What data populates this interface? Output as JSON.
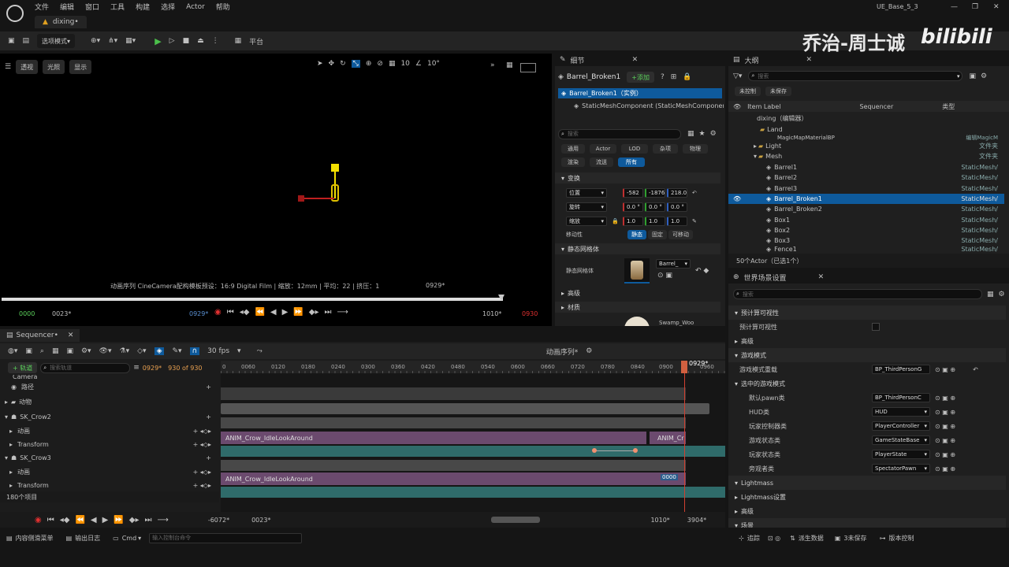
{
  "menu": {
    "items": [
      "文件",
      "编辑",
      "窗口",
      "工具",
      "构建",
      "选择",
      "Actor",
      "帮助"
    ],
    "project": "UE_Base_5_3",
    "tab": "dixing•"
  },
  "toolbar": {
    "mode": "选项模式",
    "platform": "平台"
  },
  "watermark": "乔治-周士诚",
  "viewport": {
    "perspective": "透视",
    "lit": "光照",
    "show": "显示",
    "grid": "10",
    "angle": "10°",
    "info": "动画序列 CineCamera配构模板预设：16:9 Digital Film | 缩放：12mm | 平均：22 | 挤压：1",
    "frame": "0929*",
    "start": "0000",
    "sub": "0023*",
    "cur": "0929*",
    "end": "1010*",
    "endred": "0930"
  },
  "details": {
    "tab": "细节",
    "actor": "Barrel_Broken1",
    "add": "+添加",
    "instance": "Barrel_Broken1（实例）",
    "component": "StaticMeshComponent (StaticMeshComponent)",
    "search": "搜索",
    "filters": [
      "通用",
      "Actor",
      "LOD",
      "杂项",
      "物理",
      "渲染",
      "流送",
      "所有"
    ],
    "transform": "变换",
    "loc": "位置",
    "rot": "旋转",
    "scale": "缩放",
    "lx": "-582",
    "ly": "-1876",
    "lz": "218.0",
    "rx": "0.0 °",
    "ry": "0.0 °",
    "rz": "0.0 °",
    "sx": "1.0",
    "sy": "1.0",
    "sz": "1.0",
    "mobility": "移动性",
    "mob": [
      "静态",
      "固定",
      "可移动"
    ],
    "meshsec": "静态网格体",
    "meshlabel": "静态网格体",
    "meshval": "Barrel_",
    "adv": "高级",
    "mat": "材质",
    "matval": "Swamp_Woo"
  },
  "outliner": {
    "tab": "大纲",
    "search": "搜索",
    "unsaved": "未控制",
    "unsaved2": "未保存",
    "col_label": "Item Label",
    "col_seq": "Sequencer",
    "col_type": "类型",
    "items": [
      {
        "name": "dixing（编辑器）",
        "type": "",
        "indent": 16
      },
      {
        "name": "Land",
        "type": "",
        "indent": 28
      },
      {
        "name": "MagicMapMaterialBP",
        "type": "编辑MagicM",
        "indent": 44
      },
      {
        "name": "Light",
        "type": "文件夹",
        "indent": 28
      },
      {
        "name": "Mesh",
        "type": "文件夹",
        "indent": 28
      },
      {
        "name": "Barrel1",
        "type": "StaticMesh/",
        "indent": 44
      },
      {
        "name": "Barrel2",
        "type": "StaticMesh/",
        "indent": 44
      },
      {
        "name": "Barrel3",
        "type": "StaticMesh/",
        "indent": 44
      },
      {
        "name": "Barrel_Broken1",
        "type": "StaticMesh/",
        "indent": 44
      },
      {
        "name": "Barrel_Broken2",
        "type": "StaticMesh/",
        "indent": 44
      },
      {
        "name": "Box1",
        "type": "StaticMesh/",
        "indent": 44
      },
      {
        "name": "Box2",
        "type": "StaticMesh/",
        "indent": 44
      },
      {
        "name": "Box3",
        "type": "StaticMesh/",
        "indent": 44
      },
      {
        "name": "Fence1",
        "type": "StaticMesh/",
        "indent": 44
      }
    ],
    "count": "50个Actor（已选1个）"
  },
  "world": {
    "tab": "世界场景设置",
    "search": "搜索",
    "sections": [
      {
        "t": "预计算可视性",
        "k": "h"
      },
      {
        "t": "预计算可视性",
        "k": "r",
        "v": ""
      },
      {
        "t": "高级",
        "k": "h"
      },
      {
        "t": "游戏模式",
        "k": "h"
      },
      {
        "t": "游戏模式重载",
        "k": "r",
        "v": "BP_ThirdPersonG"
      },
      {
        "t": "选中的游戏模式",
        "k": "h"
      },
      {
        "t": "默认pawn类",
        "k": "r",
        "v": "BP_ThirdPersonC"
      },
      {
        "t": "HUD类",
        "k": "r",
        "v": "HUD"
      },
      {
        "t": "玩家控制器类",
        "k": "r",
        "v": "PlayerController"
      },
      {
        "t": "游戏状态类",
        "k": "r",
        "v": "GameStateBase"
      },
      {
        "t": "玩家状态类",
        "k": "r",
        "v": "PlayerState"
      },
      {
        "t": "旁观者类",
        "k": "r",
        "v": "SpectatorPawn"
      },
      {
        "t": "Lightmass",
        "k": "h"
      },
      {
        "t": "Lightmass设置",
        "k": "h"
      },
      {
        "t": "高级",
        "k": "h"
      },
      {
        "t": "场景",
        "k": "h"
      }
    ]
  },
  "seq": {
    "tab": "Sequencer•",
    "fps": "30 fps",
    "seqname": "动画序列*",
    "track": "+ 轨道",
    "search": "搜索轨道",
    "cur": "0929*",
    "range": "930 of 930",
    "ticks": [
      "0",
      "0060",
      "0120",
      "0180",
      "0240",
      "0300",
      "0360",
      "0420",
      "0480",
      "0540",
      "0600",
      "0660",
      "0720",
      "0780",
      "0840",
      "0900",
      "0960"
    ],
    "rows": [
      {
        "n": "Camera",
        "i": "c"
      },
      {
        "n": "路径",
        "i": "p"
      },
      {
        "n": "动物",
        "i": "f"
      },
      {
        "n": "SK_Crow2",
        "i": "s"
      },
      {
        "n": "动画",
        "i": "a"
      },
      {
        "n": "Transform",
        "i": "a"
      },
      {
        "n": "SK_Crow3",
        "i": "s"
      },
      {
        "n": "动画",
        "i": "a"
      },
      {
        "n": "Transform",
        "i": "a"
      }
    ],
    "clip1": "ANIM_Crow_IdleLookAround",
    "clip1b": "ANIM_Cr",
    "clip2": "ANIM_Crow_IdleLookAround",
    "clipsel": "0000",
    "count": "180个项目",
    "bstart": "-6072*",
    "bsub": "0023*",
    "bend": "1010*",
    "bend2": "3904*"
  },
  "status": {
    "drawer": "内容侧滑菜单",
    "log": "输出日志",
    "cmd": "Cmd",
    "input": "输入控制台命令",
    "track": "追踪",
    "src": "派生数据",
    "save": "3未保存",
    "vc": "版本控制"
  }
}
